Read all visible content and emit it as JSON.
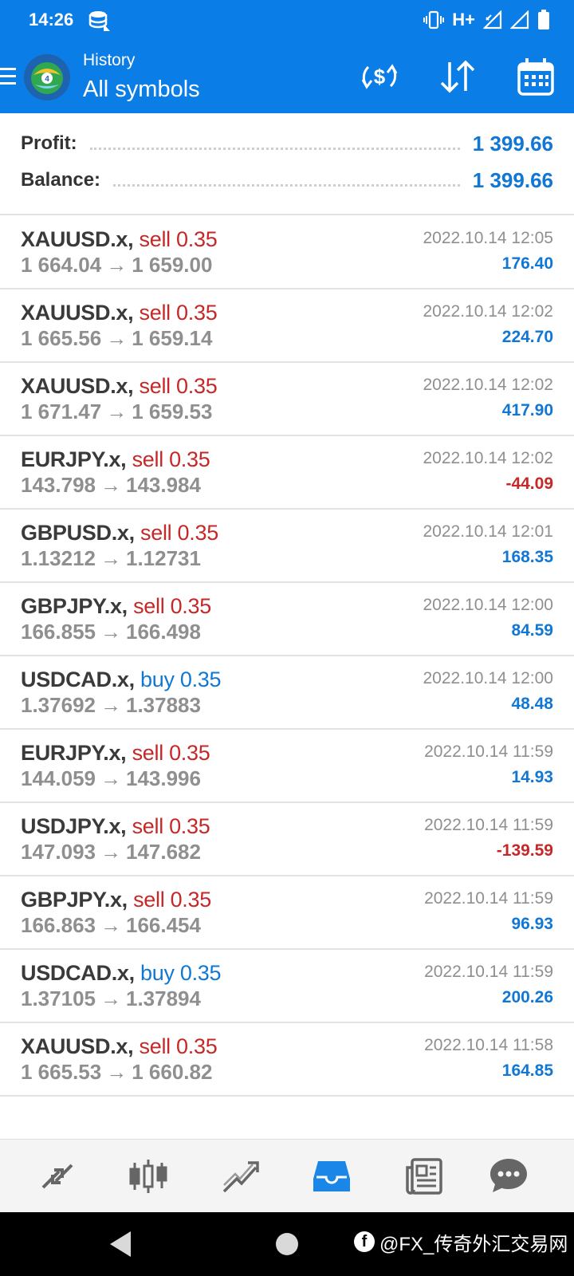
{
  "status_bar": {
    "time": "14:26",
    "network": "H+",
    "icons": [
      "data-saver-icon",
      "vibrate-icon",
      "signal-icon",
      "signal-icon",
      "battery-icon"
    ]
  },
  "header": {
    "subtitle": "History",
    "title": "All symbols",
    "icons": [
      "menu-icon",
      "metatrader-logo",
      "currency-exchange-icon",
      "sort-icon",
      "calendar-icon"
    ]
  },
  "summary": {
    "profit_label": "Profit:",
    "profit_value": "1 399.66",
    "balance_label": "Balance:",
    "balance_value": "1 399.66"
  },
  "deals": [
    {
      "symbol": "XAUUSD.x,",
      "side": "sell 0.35",
      "type": "sell",
      "open": "1 664.04",
      "close": "1 659.00",
      "time": "2022.10.14 12:05",
      "profit": "176.40",
      "sign": "pos"
    },
    {
      "symbol": "XAUUSD.x,",
      "side": "sell 0.35",
      "type": "sell",
      "open": "1 665.56",
      "close": "1 659.14",
      "time": "2022.10.14 12:02",
      "profit": "224.70",
      "sign": "pos"
    },
    {
      "symbol": "XAUUSD.x,",
      "side": "sell 0.35",
      "type": "sell",
      "open": "1 671.47",
      "close": "1 659.53",
      "time": "2022.10.14 12:02",
      "profit": "417.90",
      "sign": "pos"
    },
    {
      "symbol": "EURJPY.x,",
      "side": "sell 0.35",
      "type": "sell",
      "open": "143.798",
      "close": "143.984",
      "time": "2022.10.14 12:02",
      "profit": "-44.09",
      "sign": "neg"
    },
    {
      "symbol": "GBPUSD.x,",
      "side": "sell 0.35",
      "type": "sell",
      "open": "1.13212",
      "close": "1.12731",
      "time": "2022.10.14 12:01",
      "profit": "168.35",
      "sign": "pos"
    },
    {
      "symbol": "GBPJPY.x,",
      "side": "sell 0.35",
      "type": "sell",
      "open": "166.855",
      "close": "166.498",
      "time": "2022.10.14 12:00",
      "profit": "84.59",
      "sign": "pos"
    },
    {
      "symbol": "USDCAD.x,",
      "side": "buy 0.35",
      "type": "buy",
      "open": "1.37692",
      "close": "1.37883",
      "time": "2022.10.14 12:00",
      "profit": "48.48",
      "sign": "pos"
    },
    {
      "symbol": "EURJPY.x,",
      "side": "sell 0.35",
      "type": "sell",
      "open": "144.059",
      "close": "143.996",
      "time": "2022.10.14 11:59",
      "profit": "14.93",
      "sign": "pos"
    },
    {
      "symbol": "USDJPY.x,",
      "side": "sell 0.35",
      "type": "sell",
      "open": "147.093",
      "close": "147.682",
      "time": "2022.10.14 11:59",
      "profit": "-139.59",
      "sign": "neg"
    },
    {
      "symbol": "GBPJPY.x,",
      "side": "sell 0.35",
      "type": "sell",
      "open": "166.863",
      "close": "166.454",
      "time": "2022.10.14 11:59",
      "profit": "96.93",
      "sign": "pos"
    },
    {
      "symbol": "USDCAD.x,",
      "side": "buy 0.35",
      "type": "buy",
      "open": "1.37105",
      "close": "1.37894",
      "time": "2022.10.14 11:59",
      "profit": "200.26",
      "sign": "pos"
    },
    {
      "symbol": "XAUUSD.x,",
      "side": "sell 0.35",
      "type": "sell",
      "open": "1 665.53",
      "close": "1 660.82",
      "time": "2022.10.14 11:58",
      "profit": "164.85",
      "sign": "pos"
    }
  ],
  "arrow_glyph": "→",
  "bottom_nav": {
    "items": [
      "quotes-icon",
      "chart-icon",
      "trade-icon",
      "history-icon",
      "news-icon",
      "chat-icon"
    ],
    "active": "history-icon"
  },
  "system_nav": {
    "watermark": "@FX_传奇外汇交易网"
  },
  "colors": {
    "accent": "#0a7de6",
    "positive": "#1177d4",
    "negative": "#c62828",
    "muted": "#8f8f8f"
  }
}
